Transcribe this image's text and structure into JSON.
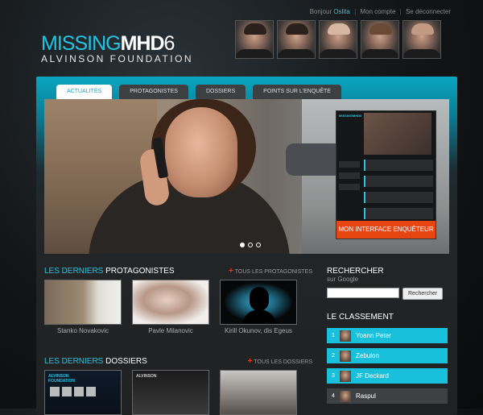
{
  "topbar": {
    "greeting": "Bonjour",
    "user": "Oslita",
    "account": "Mon compte",
    "logout": "Se déconnecter",
    "separator": "|"
  },
  "logo": {
    "part_a": "MISSING",
    "part_b": "MHD",
    "part_c": "6",
    "subtitle": "ALVINSON FOUNDATION"
  },
  "tabs": [
    "Actualités",
    "Protagonistes",
    "Dossiers",
    "Points sur l'enquête"
  ],
  "hero": {
    "cta": "Mon interface enquêteur",
    "inset_logo": "MISSINGMHD6",
    "slides": 3,
    "active_slide": 1
  },
  "protagonists": {
    "title_hl": "Les derniers",
    "title": "protagonistes",
    "all_link": "Tous les protagonistes",
    "items": [
      {
        "name": "Stanko Novakovic"
      },
      {
        "name": "Pavle Milanovic"
      },
      {
        "name": "Kirill Okunov, dis Egeus"
      }
    ]
  },
  "dossiers": {
    "title_hl": "Les derniers",
    "title": "dossiers",
    "all_link": "Tous les dossiers",
    "thumb_label_a": "ALVINSON",
    "thumb_label_b": "FOUNDATION",
    "thumb2_label": "ALVINSON"
  },
  "search": {
    "title": "Rechercher",
    "subtitle": "sur Google",
    "placeholder": "",
    "button": "Rechercher"
  },
  "ranking": {
    "title": "Le classement",
    "items": [
      {
        "rank": "1",
        "name": "Yoann Peter"
      },
      {
        "rank": "2",
        "name": "Zebulon"
      },
      {
        "rank": "3",
        "name": "JF Deckard"
      },
      {
        "rank": "4",
        "name": "Raspul"
      }
    ]
  },
  "colors": {
    "accent": "#18c0dc",
    "cta": "#e64512",
    "plus": "#e63a1a"
  }
}
